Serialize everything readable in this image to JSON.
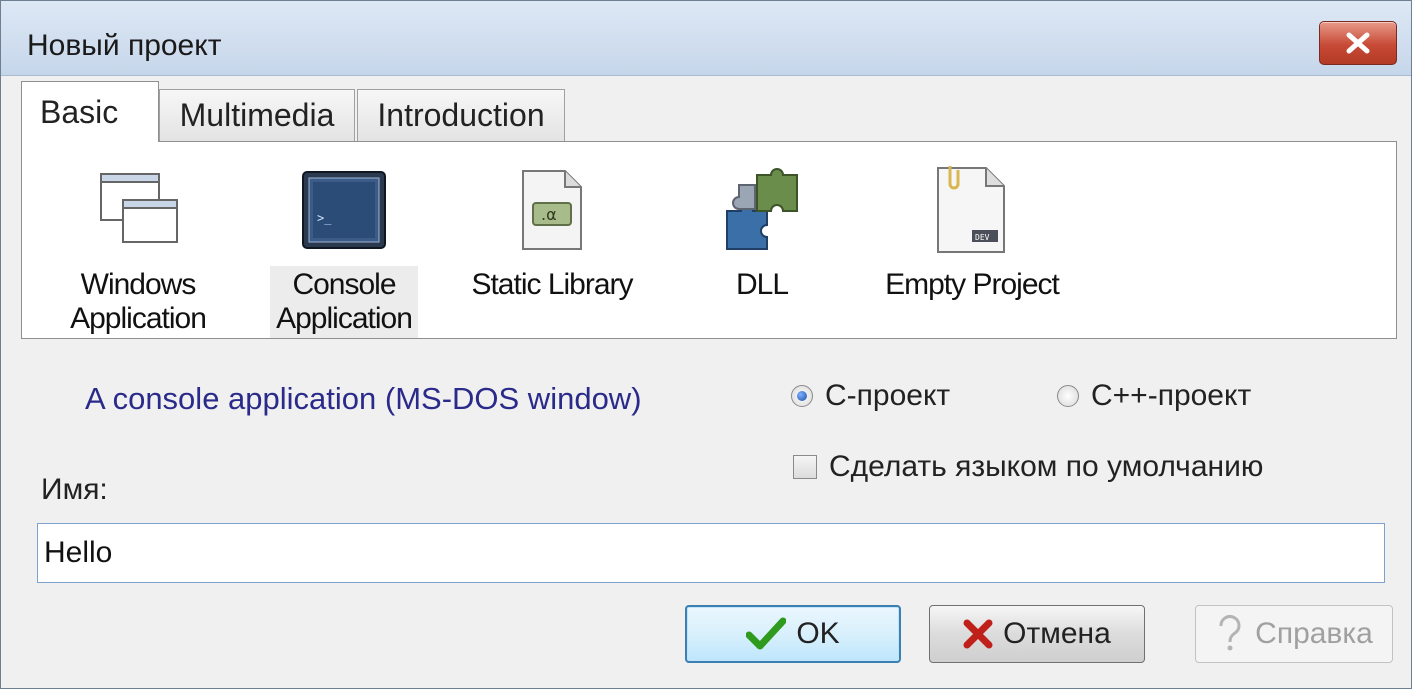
{
  "window": {
    "title": "Новый проект",
    "close_label": "x"
  },
  "tabs": [
    {
      "label": "Basic",
      "active": true
    },
    {
      "label": "Multimedia",
      "active": false
    },
    {
      "label": "Introduction",
      "active": false
    }
  ],
  "project_types": [
    {
      "label_line1": "Windows",
      "label_line2": "Application",
      "icon": "windows-app-icon",
      "selected": false
    },
    {
      "label_line1": "Console",
      "label_line2": "Application",
      "icon": "console-app-icon",
      "selected": true
    },
    {
      "label_line1": "Static Library",
      "label_line2": "",
      "icon": "static-library-icon",
      "selected": false
    },
    {
      "label_line1": "DLL",
      "label_line2": "",
      "icon": "dll-puzzle-icon",
      "selected": false
    },
    {
      "label_line1": "Empty Project",
      "label_line2": "",
      "icon": "empty-project-icon",
      "selected": false
    }
  ],
  "description": "A console application (MS-DOS window)",
  "language": {
    "c_label": "C-проект",
    "cpp_label": "C++-проект",
    "selected": "C-проект",
    "default_label": "Сделать языком по умолчанию",
    "default_checked": false
  },
  "name": {
    "label": "Имя:",
    "value": "Hello"
  },
  "buttons": {
    "ok": "OK",
    "cancel": "Отмена",
    "help": "Справка"
  },
  "colors": {
    "description_text": "#2a2a8a",
    "close_button": "#c74a36",
    "ok_check": "#2e9a1e",
    "cancel_x": "#c0201a"
  }
}
